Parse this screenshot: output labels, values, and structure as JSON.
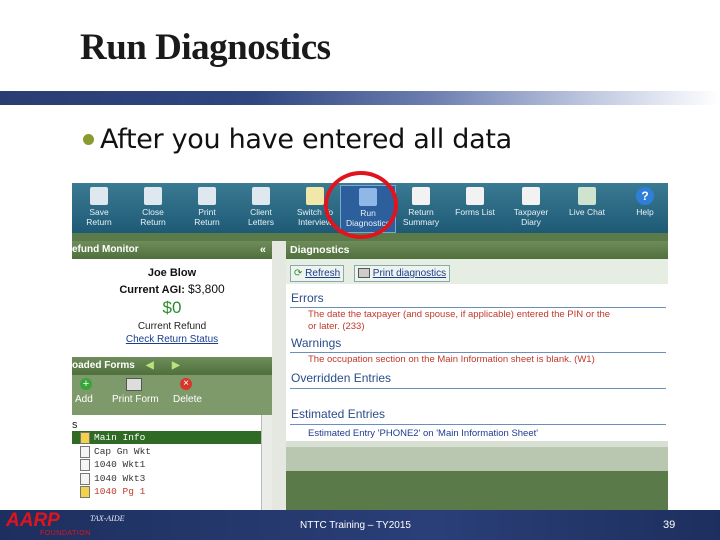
{
  "slide": {
    "title": "Run Diagnostics",
    "bullet": "After you have entered all data",
    "footer_left": "TAX-AIDE",
    "footer_center": "NTTC Training – TY2015",
    "page_number": "39",
    "logo_text": "AARP",
    "logo_sub": "FOUNDATION"
  },
  "toolbar": {
    "buttons": [
      {
        "label1": "Save",
        "label2": "Return"
      },
      {
        "label1": "Close",
        "label2": "Return"
      },
      {
        "label1": "Print",
        "label2": "Return"
      },
      {
        "label1": "Client",
        "label2": "Letters"
      },
      {
        "label1": "Switch To",
        "label2": "Interview"
      },
      {
        "label1": "Run",
        "label2": "Diagnostics"
      },
      {
        "label1": "Return",
        "label2": "Summary"
      },
      {
        "label1": "Forms List",
        "label2": ""
      },
      {
        "label1": "Taxpayer",
        "label2": "Diary"
      },
      {
        "label1": "Live Chat",
        "label2": ""
      },
      {
        "label1": "Help",
        "label2": ""
      }
    ]
  },
  "refund_monitor": {
    "header": "efund Monitor",
    "name": "Joe Blow",
    "agi_label": "Current AGI:",
    "agi_value": "$3,800",
    "refund_value": "$0",
    "refund_label": "Current Refund",
    "link": "Check Return Status"
  },
  "loaded_forms": {
    "header": "oaded Forms",
    "add": "Add",
    "print_form": "Print Form",
    "delete": "Delete",
    "s_label": "s",
    "items": [
      "Main Info",
      "Cap Gn Wkt",
      "1040 Wkt1",
      "1040 Wkt3",
      "1040 Pg 1"
    ]
  },
  "diagnostics": {
    "header": "Diagnostics",
    "refresh": "Refresh",
    "print": "Print diagnostics",
    "errors_title": "Errors",
    "error_line1": "The date the taxpayer (and spouse, if applicable) entered the PIN or the",
    "error_line2": "or later. (233)",
    "warnings_title": "Warnings",
    "warning_line": "The occupation section on the Main Information sheet is blank. (W1)",
    "overridden_title": "Overridden Entries",
    "estimated_title": "Estimated Entries",
    "estimated_line": "Estimated Entry 'PHONE2' on 'Main Information Sheet'"
  },
  "colors": {
    "accent_red": "#e0141e",
    "toolbar": "#2b6c88",
    "footer": "#1d2f5e"
  }
}
